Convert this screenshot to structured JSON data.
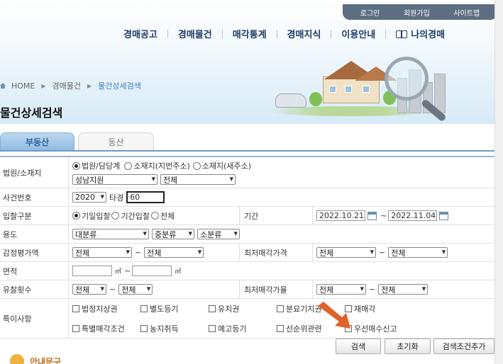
{
  "util": [
    "로그인",
    "회원가입",
    "사이트맵"
  ],
  "gnb": [
    "경매공고",
    "경매물건",
    "매각통계",
    "경매지식",
    "이용안내",
    "나의경매"
  ],
  "breadcrumb": [
    "HOME",
    "경매물건",
    "물건상세검색"
  ],
  "page_title": "물건상세검색",
  "tabs": [
    "부동산",
    "동산"
  ],
  "colors": {
    "accent": "#2d5f97",
    "tab_line": "#6f9ac6",
    "arrow": "#e0612a"
  },
  "rows": {
    "location": {
      "label": "법원/소재지",
      "radios": [
        "법원/담당계",
        "소재지(지번주소)",
        "소재지(새주소)"
      ],
      "court": "성남지원",
      "dept": "전체"
    },
    "case": {
      "label": "사건번호",
      "year": "2020",
      "sep": "타경",
      "number": "60"
    },
    "bid": {
      "label": "입찰구분",
      "radios": [
        "기일입찰",
        "기간입찰",
        "전체"
      ],
      "period_label": "기간",
      "from": "2022.10.21",
      "tilde": "~",
      "to": "2022.11.04"
    },
    "usage": {
      "label": "용도",
      "major": "대분류",
      "middle": "중분류",
      "minor": "소분류"
    },
    "appraisal": {
      "label": "감정평가액",
      "from": "전체",
      "to": "전체",
      "min_label": "최저매각가격",
      "min_from": "전체",
      "min_to": "전체"
    },
    "area": {
      "label": "면적",
      "unit": "㎡",
      "tilde": "~"
    },
    "fail": {
      "label": "유찰횟수",
      "from": "전체",
      "to": "전체",
      "rate_label": "최저매각가율",
      "rate_from": "전체",
      "rate_to": "전체"
    },
    "special": {
      "label": "특이사항",
      "checks_row1": [
        "법정지상권",
        "별도등기",
        "유치권",
        "분묘기지권",
        "재매각"
      ],
      "checks_row2": [
        "특별매각조건",
        "농지취득",
        "예고등기",
        "선순위관련",
        "우선매수신고"
      ]
    }
  },
  "buttons": {
    "search": "검색",
    "reset": "초기화",
    "add": "검색조건추가"
  },
  "guide": "안내문구"
}
